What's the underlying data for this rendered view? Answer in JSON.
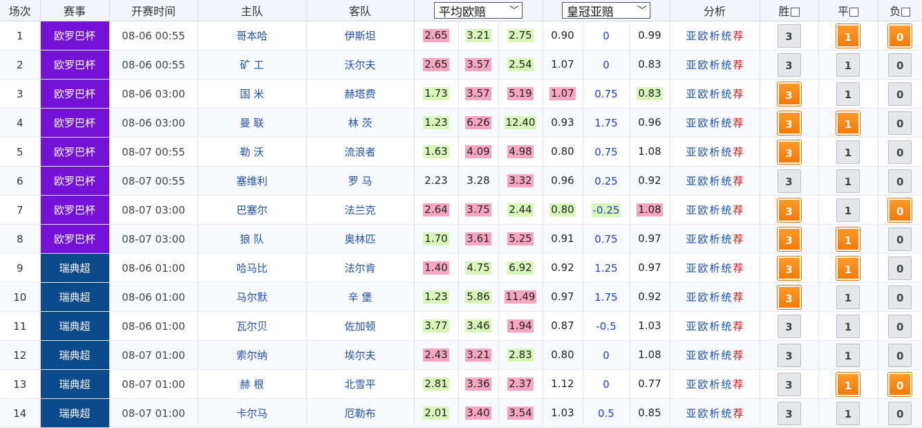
{
  "header": {
    "seq": "场次",
    "league": "赛事",
    "time": "开赛时间",
    "home": "主队",
    "away": "客队",
    "euro_select": "平均欧赔",
    "asia_select": "皇冠亚赔",
    "analysis": "分析",
    "win": "胜",
    "draw": "平",
    "lose": "负"
  },
  "colors": {
    "league_europa": "#7412d8",
    "league_allsvenskan": "#0c4b8b",
    "odd_high": "#f8a5c0",
    "odd_low": "#d8f6b8",
    "pick_active": "#f57a05"
  },
  "analysis_links": [
    "亚",
    "欧",
    "析",
    "统",
    "荐"
  ],
  "matches": [
    {
      "seq": "1",
      "league": "欧罗巴杯",
      "lc": "eu",
      "time": "08-06 00:55",
      "home": "哥本哈",
      "away": "伊斯坦",
      "euro": [
        {
          "v": "2.65",
          "c": "red"
        },
        {
          "v": "3.21",
          "c": "green"
        },
        {
          "v": "2.75",
          "c": "green"
        }
      ],
      "asia": [
        {
          "v": "0.90",
          "c": ""
        },
        {
          "v": "0",
          "c": ""
        },
        {
          "v": "0.99",
          "c": ""
        }
      ],
      "picks": [
        {
          "v": "3",
          "on": false
        },
        {
          "v": "1",
          "on": true
        },
        {
          "v": "0",
          "on": true
        }
      ]
    },
    {
      "seq": "2",
      "league": "欧罗巴杯",
      "lc": "eu",
      "time": "08-06 00:55",
      "home": "矿 工",
      "away": "沃尔夫",
      "euro": [
        {
          "v": "2.65",
          "c": "red"
        },
        {
          "v": "3.57",
          "c": "red"
        },
        {
          "v": "2.54",
          "c": "green"
        }
      ],
      "asia": [
        {
          "v": "1.07",
          "c": ""
        },
        {
          "v": "0",
          "c": ""
        },
        {
          "v": "0.83",
          "c": ""
        }
      ],
      "picks": [
        {
          "v": "3",
          "on": false
        },
        {
          "v": "1",
          "on": false
        },
        {
          "v": "0",
          "on": false
        }
      ]
    },
    {
      "seq": "3",
      "league": "欧罗巴杯",
      "lc": "eu",
      "time": "08-06 03:00",
      "home": "国 米",
      "away": "赫塔费",
      "euro": [
        {
          "v": "1.73",
          "c": "green"
        },
        {
          "v": "3.57",
          "c": "red"
        },
        {
          "v": "5.19",
          "c": "red"
        }
      ],
      "asia": [
        {
          "v": "1.07",
          "c": "red"
        },
        {
          "v": "0.75",
          "c": ""
        },
        {
          "v": "0.83",
          "c": "green"
        }
      ],
      "picks": [
        {
          "v": "3",
          "on": true
        },
        {
          "v": "1",
          "on": false
        },
        {
          "v": "0",
          "on": false
        }
      ]
    },
    {
      "seq": "4",
      "league": "欧罗巴杯",
      "lc": "eu",
      "time": "08-06 03:00",
      "home": "曼 联",
      "away": "林 茨",
      "euro": [
        {
          "v": "1.23",
          "c": "green"
        },
        {
          "v": "6.26",
          "c": "red"
        },
        {
          "v": "12.40",
          "c": "green"
        }
      ],
      "asia": [
        {
          "v": "0.93",
          "c": ""
        },
        {
          "v": "1.75",
          "c": ""
        },
        {
          "v": "0.96",
          "c": ""
        }
      ],
      "picks": [
        {
          "v": "3",
          "on": true
        },
        {
          "v": "1",
          "on": true
        },
        {
          "v": "0",
          "on": false
        }
      ]
    },
    {
      "seq": "5",
      "league": "欧罗巴杯",
      "lc": "eu",
      "time": "08-07 00:55",
      "home": "勒 沃",
      "away": "流浪者",
      "euro": [
        {
          "v": "1.63",
          "c": "green"
        },
        {
          "v": "4.09",
          "c": "red"
        },
        {
          "v": "4.98",
          "c": "red"
        }
      ],
      "asia": [
        {
          "v": "0.80",
          "c": ""
        },
        {
          "v": "0.75",
          "c": ""
        },
        {
          "v": "1.08",
          "c": ""
        }
      ],
      "picks": [
        {
          "v": "3",
          "on": true
        },
        {
          "v": "1",
          "on": false
        },
        {
          "v": "0",
          "on": false
        }
      ]
    },
    {
      "seq": "6",
      "league": "欧罗巴杯",
      "lc": "eu",
      "time": "08-07 00:55",
      "home": "塞维利",
      "away": "罗 马",
      "euro": [
        {
          "v": "2.23",
          "c": ""
        },
        {
          "v": "3.28",
          "c": ""
        },
        {
          "v": "3.32",
          "c": "red"
        }
      ],
      "asia": [
        {
          "v": "0.96",
          "c": ""
        },
        {
          "v": "0.25",
          "c": ""
        },
        {
          "v": "0.92",
          "c": ""
        }
      ],
      "picks": [
        {
          "v": "3",
          "on": false
        },
        {
          "v": "1",
          "on": false
        },
        {
          "v": "0",
          "on": false
        }
      ]
    },
    {
      "seq": "7",
      "league": "欧罗巴杯",
      "lc": "eu",
      "time": "08-07 03:00",
      "home": "巴塞尔",
      "away": "法兰克",
      "euro": [
        {
          "v": "2.64",
          "c": "red"
        },
        {
          "v": "3.75",
          "c": "red"
        },
        {
          "v": "2.44",
          "c": "green"
        }
      ],
      "asia": [
        {
          "v": "0.80",
          "c": "green"
        },
        {
          "v": "-0.25",
          "c": "green"
        },
        {
          "v": "1.08",
          "c": "red"
        }
      ],
      "picks": [
        {
          "v": "3",
          "on": true
        },
        {
          "v": "1",
          "on": false
        },
        {
          "v": "0",
          "on": true
        }
      ]
    },
    {
      "seq": "8",
      "league": "欧罗巴杯",
      "lc": "eu",
      "time": "08-07 03:00",
      "home": "狼 队",
      "away": "奥林匹",
      "euro": [
        {
          "v": "1.70",
          "c": "green"
        },
        {
          "v": "3.61",
          "c": "red"
        },
        {
          "v": "5.25",
          "c": "red"
        }
      ],
      "asia": [
        {
          "v": "0.91",
          "c": ""
        },
        {
          "v": "0.75",
          "c": ""
        },
        {
          "v": "0.97",
          "c": ""
        }
      ],
      "picks": [
        {
          "v": "3",
          "on": true
        },
        {
          "v": "1",
          "on": true
        },
        {
          "v": "0",
          "on": false
        }
      ]
    },
    {
      "seq": "9",
      "league": "瑞典超",
      "lc": "sw",
      "time": "08-06 01:00",
      "home": "哈马比",
      "away": "法尔肯",
      "euro": [
        {
          "v": "1.40",
          "c": "red"
        },
        {
          "v": "4.75",
          "c": "green"
        },
        {
          "v": "6.92",
          "c": "green"
        }
      ],
      "asia": [
        {
          "v": "0.92",
          "c": ""
        },
        {
          "v": "1.25",
          "c": ""
        },
        {
          "v": "0.97",
          "c": ""
        }
      ],
      "picks": [
        {
          "v": "3",
          "on": true
        },
        {
          "v": "1",
          "on": true
        },
        {
          "v": "0",
          "on": false
        }
      ]
    },
    {
      "seq": "10",
      "league": "瑞典超",
      "lc": "sw",
      "time": "08-06 01:00",
      "home": "马尔默",
      "away": "辛 堡",
      "euro": [
        {
          "v": "1.23",
          "c": "green"
        },
        {
          "v": "5.86",
          "c": "green"
        },
        {
          "v": "11.49",
          "c": "red"
        }
      ],
      "asia": [
        {
          "v": "0.97",
          "c": ""
        },
        {
          "v": "1.75",
          "c": ""
        },
        {
          "v": "0.92",
          "c": ""
        }
      ],
      "picks": [
        {
          "v": "3",
          "on": true
        },
        {
          "v": "1",
          "on": false
        },
        {
          "v": "0",
          "on": false
        }
      ]
    },
    {
      "seq": "11",
      "league": "瑞典超",
      "lc": "sw",
      "time": "08-06 01:00",
      "home": "瓦尔贝",
      "away": "佐加顿",
      "euro": [
        {
          "v": "3.77",
          "c": "green"
        },
        {
          "v": "3.46",
          "c": "green"
        },
        {
          "v": "1.94",
          "c": "red"
        }
      ],
      "asia": [
        {
          "v": "0.87",
          "c": ""
        },
        {
          "v": "-0.5",
          "c": ""
        },
        {
          "v": "1.03",
          "c": ""
        }
      ],
      "picks": [
        {
          "v": "3",
          "on": false
        },
        {
          "v": "1",
          "on": false
        },
        {
          "v": "0",
          "on": false
        }
      ]
    },
    {
      "seq": "12",
      "league": "瑞典超",
      "lc": "sw",
      "time": "08-07 01:00",
      "home": "索尔纳",
      "away": "埃尔夫",
      "euro": [
        {
          "v": "2.43",
          "c": "red"
        },
        {
          "v": "3.21",
          "c": "red"
        },
        {
          "v": "2.83",
          "c": "green"
        }
      ],
      "asia": [
        {
          "v": "0.80",
          "c": ""
        },
        {
          "v": "0",
          "c": ""
        },
        {
          "v": "1.08",
          "c": ""
        }
      ],
      "picks": [
        {
          "v": "3",
          "on": false
        },
        {
          "v": "1",
          "on": false
        },
        {
          "v": "0",
          "on": false
        }
      ]
    },
    {
      "seq": "13",
      "league": "瑞典超",
      "lc": "sw",
      "time": "08-07 01:00",
      "home": "赫 根",
      "away": "北雪平",
      "euro": [
        {
          "v": "2.81",
          "c": "green"
        },
        {
          "v": "3.36",
          "c": "red"
        },
        {
          "v": "2.37",
          "c": "red"
        }
      ],
      "asia": [
        {
          "v": "1.12",
          "c": ""
        },
        {
          "v": "0",
          "c": ""
        },
        {
          "v": "0.77",
          "c": ""
        }
      ],
      "picks": [
        {
          "v": "3",
          "on": false
        },
        {
          "v": "1",
          "on": true
        },
        {
          "v": "0",
          "on": true
        }
      ]
    },
    {
      "seq": "14",
      "league": "瑞典超",
      "lc": "sw",
      "time": "08-07 01:00",
      "home": "卡尔马",
      "away": "厄勒布",
      "euro": [
        {
          "v": "2.01",
          "c": "green"
        },
        {
          "v": "3.40",
          "c": "red"
        },
        {
          "v": "3.54",
          "c": "red"
        }
      ],
      "asia": [
        {
          "v": "1.03",
          "c": ""
        },
        {
          "v": "0.5",
          "c": ""
        },
        {
          "v": "0.85",
          "c": ""
        }
      ],
      "picks": [
        {
          "v": "3",
          "on": false
        },
        {
          "v": "1",
          "on": false
        },
        {
          "v": "0",
          "on": false
        }
      ]
    }
  ]
}
